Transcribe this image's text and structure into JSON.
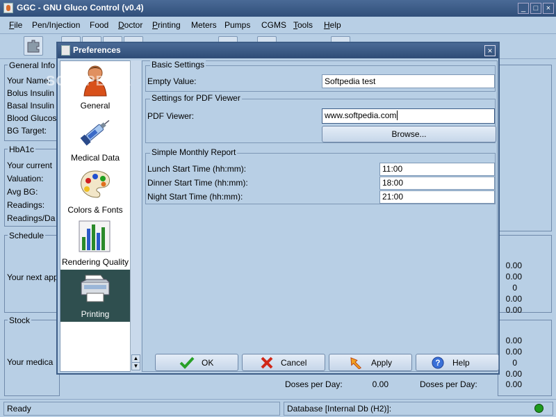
{
  "window": {
    "title": "GGC - GNU Gluco Control (v0.4)"
  },
  "menu": {
    "items": [
      {
        "mn": "F",
        "rest": "ile"
      },
      {
        "mn": "",
        "rest": "Pen/Injection"
      },
      {
        "mn": "",
        "rest": "Food"
      },
      {
        "mn": "D",
        "rest": "octor"
      },
      {
        "mn": "P",
        "rest": "rinting"
      },
      {
        "mn": "",
        "rest": "Meters"
      },
      {
        "mn": "",
        "rest": "Pumps"
      },
      {
        "mn": "",
        "rest": "CGMS"
      },
      {
        "mn": "T",
        "rest": "ools"
      },
      {
        "mn": "H",
        "rest": "elp"
      }
    ]
  },
  "main": {
    "general": {
      "legend": "General Info",
      "rows": [
        "Your Name:",
        "Bolus Insulin",
        "Basal Insulin",
        "Blood Glucos",
        "BG Target:"
      ]
    },
    "hba1c": {
      "legend": "HbA1c",
      "rows": [
        "Your current",
        "Valuation:",
        "Avg BG:",
        "Readings:",
        "Readings/Da"
      ]
    },
    "schedule": {
      "legend": "Schedule",
      "text": "Your next app"
    },
    "stock": {
      "legend": "Stock",
      "text": "Your medica"
    },
    "right_values_1": [
      "0.00",
      "0.00",
      "0",
      "0.00",
      "0.00"
    ],
    "right_values_2": [
      "0.00",
      "0.00",
      "0",
      "0.00"
    ],
    "bottom_row": {
      "left_label": "Doses per Day:",
      "left_value": "0.00",
      "right_label": "Doses per Day:",
      "right_value": "0.00"
    }
  },
  "watermark": "SOFTPEDIA",
  "status": {
    "left": "Ready",
    "right": "Database [Internal Db (H2)]:",
    "led_color": "#1e9a1e"
  },
  "dialog": {
    "title": "Preferences",
    "categories": [
      {
        "label": "General",
        "icon": "person-icon"
      },
      {
        "label": "Medical Data",
        "icon": "syringe-icon"
      },
      {
        "label": "Colors & Fonts",
        "icon": "palette-icon"
      },
      {
        "label": "Rendering Quality",
        "icon": "bar-chart-icon"
      },
      {
        "label": "Printing",
        "icon": "printer-icon",
        "selected": true
      }
    ],
    "basic": {
      "legend": "Basic Settings",
      "empty_label": "Empty Value:",
      "empty_value": "Softpedia test"
    },
    "pdf": {
      "legend": "Settings for PDF Viewer",
      "viewer_label": "PDF Viewer:",
      "viewer_value": "www.softpedia.com",
      "browse": "Browse..."
    },
    "report": {
      "legend": "Simple Monthly Report",
      "lunch_label": "Lunch Start Time (hh:mm):",
      "lunch_value": "11:00",
      "dinner_label": "Dinner Start Time (hh:mm):",
      "dinner_value": "18:00",
      "night_label": "Night Start Time (hh:mm):",
      "night_value": "21:00"
    },
    "buttons": {
      "ok": "OK",
      "cancel": "Cancel",
      "apply": "Apply",
      "help": "Help"
    }
  }
}
